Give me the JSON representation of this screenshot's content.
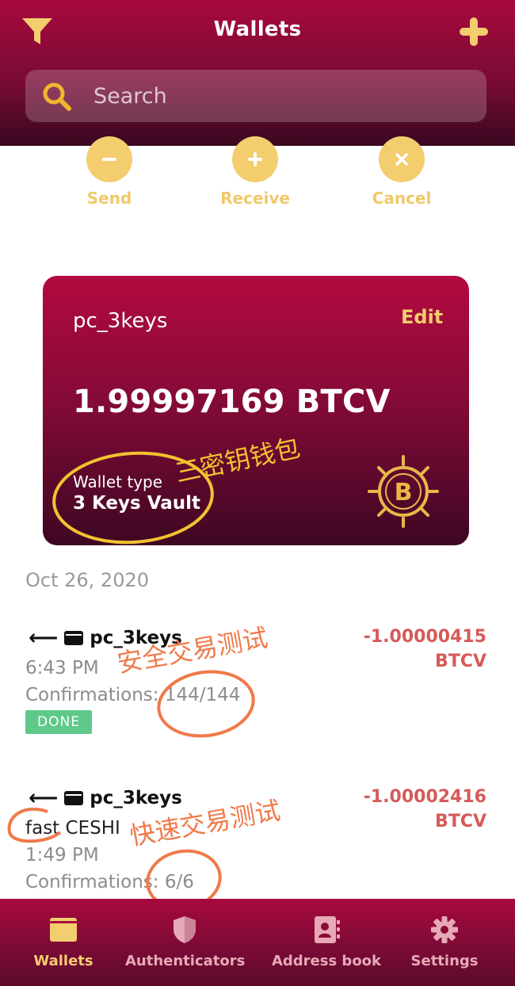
{
  "header": {
    "title": "Wallets",
    "filter_icon": "filter-icon",
    "add_icon": "plus-icon"
  },
  "search": {
    "placeholder": "Search"
  },
  "actions": [
    {
      "label": "Send",
      "icon": "minus-icon"
    },
    {
      "label": "Receive",
      "icon": "plus-icon"
    },
    {
      "label": "Cancel",
      "icon": "close-icon"
    }
  ],
  "wallet_card": {
    "name": "pc_3keys",
    "edit_label": "Edit",
    "balance": "1.99997169 BTCV",
    "type_label": "Wallet type",
    "type_value": "3 Keys Vault",
    "logo_icon": "bitcoin-vault-icon"
  },
  "transactions": {
    "date": "Oct 26, 2020",
    "items": [
      {
        "wallet": "pc_3keys",
        "time": "6:43 PM",
        "confirmations": "Confirmations: 144/144",
        "status": "DONE",
        "amount": "-1.00000415",
        "currency": "BTCV"
      },
      {
        "wallet": "pc_3keys",
        "memo": "fast CESHI",
        "time": "1:49 PM",
        "confirmations": "Confirmations: 6/6",
        "amount": "-1.00002416",
        "currency": "BTCV"
      }
    ]
  },
  "annotations": {
    "card_note": "三密钥钱包",
    "tx1_note": "安全交易测试",
    "tx2_note": "快速交易测试"
  },
  "bottom_nav": [
    {
      "label": "Wallets",
      "icon": "wallet-icon",
      "active": true
    },
    {
      "label": "Authenticators",
      "icon": "shield-icon",
      "active": false
    },
    {
      "label": "Address book",
      "icon": "address-book-icon",
      "active": false
    },
    {
      "label": "Settings",
      "icon": "gear-icon",
      "active": false
    }
  ],
  "colors": {
    "brand": "#a8093d",
    "accent": "#f3cd6e",
    "negative": "#d65a5a",
    "done": "#5fc98a",
    "annotation": "#f07a4a"
  }
}
